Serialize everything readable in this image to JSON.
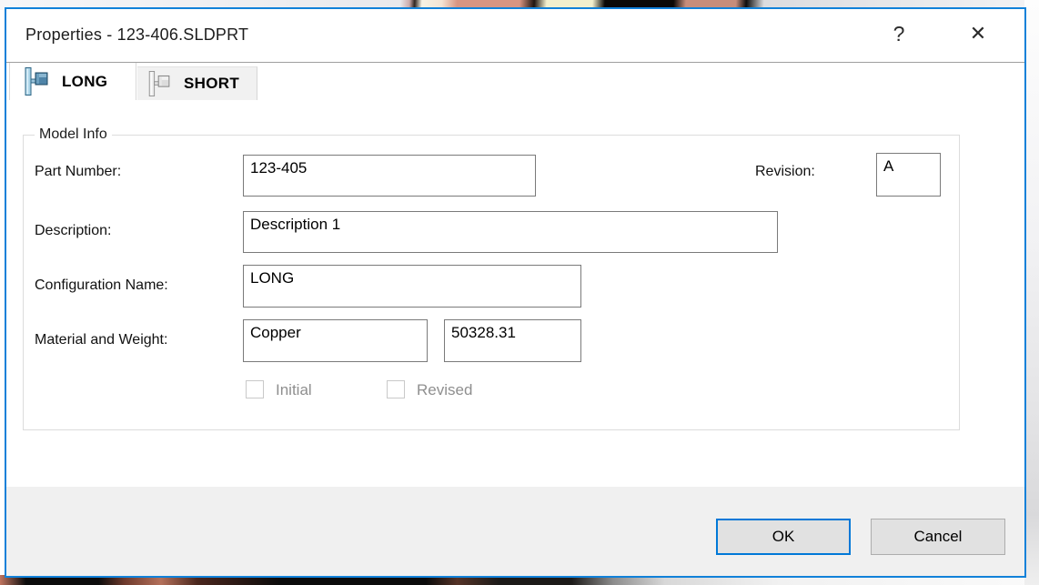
{
  "window": {
    "title": "Properties - 123-406.SLDPRT",
    "help_glyph": "?",
    "close_glyph": "✕"
  },
  "tabs": [
    {
      "label": "LONG",
      "active": true,
      "icon": "configuration-flag-icon"
    },
    {
      "label": "SHORT",
      "active": false,
      "icon": "configuration-flag-icon"
    }
  ],
  "model_info": {
    "legend": "Model Info",
    "part_number": {
      "label": "Part Number:",
      "value": "123-405"
    },
    "revision": {
      "label": "Revision:",
      "value": "A"
    },
    "description": {
      "label": "Description:",
      "value": "Description 1"
    },
    "configuration_name": {
      "label": "Configuration Name:",
      "value": "LONG"
    },
    "material_weight": {
      "label": "Material and Weight:",
      "material": "Copper",
      "weight": "50328.31"
    },
    "checkboxes": [
      {
        "label": "Initial",
        "checked": false,
        "disabled": true
      },
      {
        "label": "Revised",
        "checked": false,
        "disabled": true
      }
    ]
  },
  "footer": {
    "ok_label": "OK",
    "cancel_label": "Cancel"
  },
  "colors": {
    "dialog_border_blue": "#1181d9",
    "default_button_blue": "#0078d7",
    "footer_gray": "#f0f0f0",
    "disabled_text_gray": "#8f8f8f",
    "tab_inactive_gray": "#f1f1f1",
    "field_border_gray": "#7a7a7a"
  }
}
